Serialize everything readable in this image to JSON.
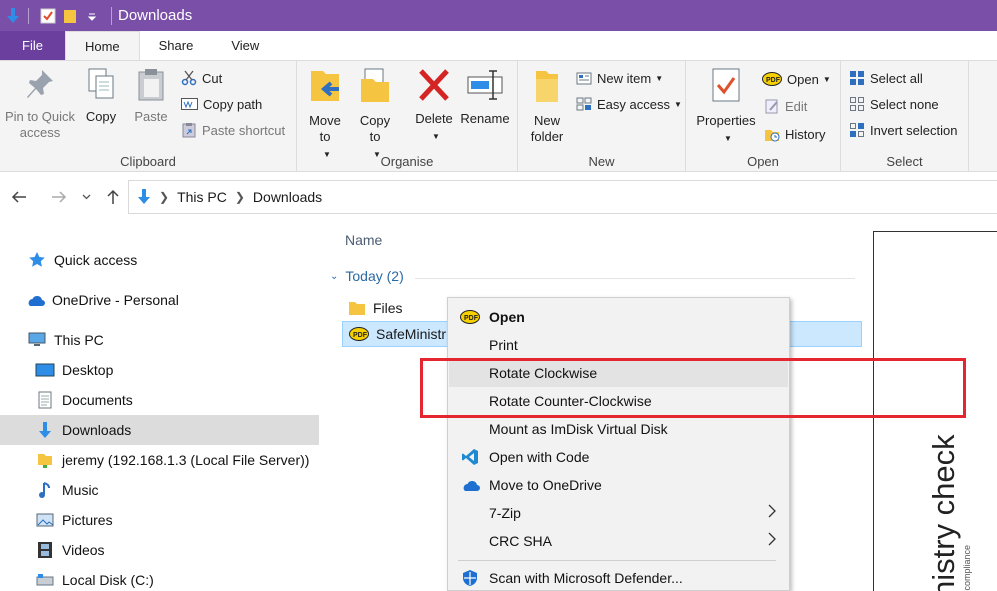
{
  "titlebar": {
    "title": "Downloads",
    "accent": "#7a4fa8"
  },
  "ribbon_tabs": [
    "File",
    "Home",
    "Share",
    "View"
  ],
  "clipboard": {
    "pin": "Pin to Quick access",
    "copy": "Copy",
    "paste": "Paste",
    "cut": "Cut",
    "copy_path": "Copy path",
    "paste_shortcut": "Paste shortcut",
    "label": "Clipboard"
  },
  "organise": {
    "move_to": "Move to",
    "copy_to": "Copy to",
    "delete": "Delete",
    "rename": "Rename",
    "label": "Organise"
  },
  "new_group": {
    "new_folder": "New folder",
    "new_item": "New item",
    "easy_access": "Easy access",
    "label": "New"
  },
  "open_group": {
    "properties": "Properties",
    "open": "Open",
    "edit": "Edit",
    "history": "History",
    "label": "Open"
  },
  "select_group": {
    "select_all": "Select all",
    "select_none": "Select none",
    "invert": "Invert selection",
    "label": "Select"
  },
  "address": {
    "crumbs": [
      "This PC",
      "Downloads"
    ]
  },
  "navpane": {
    "items": [
      "Quick access",
      "OneDrive - Personal",
      "This PC",
      "Desktop",
      "Documents",
      "Downloads",
      "jeremy (192.168.1.3 (Local File Server))",
      "Music",
      "Pictures",
      "Videos",
      "Local Disk (C:)"
    ]
  },
  "filelist": {
    "column_name": "Name",
    "group_header": "Today (2)",
    "files": [
      "Files",
      "SafeMinistr"
    ]
  },
  "preview": {
    "title_text": "nistry check",
    "subtitle_text": "e compliance"
  },
  "context_menu": {
    "items": [
      "Open",
      "Print",
      "Rotate Clockwise",
      "Rotate Counter-Clockwise",
      "Mount as ImDisk Virtual Disk",
      "Open with Code",
      "Move to OneDrive",
      "7-Zip",
      "CRC SHA",
      "Scan with Microsoft Defender..."
    ]
  },
  "highlight_color": "#e3262f"
}
